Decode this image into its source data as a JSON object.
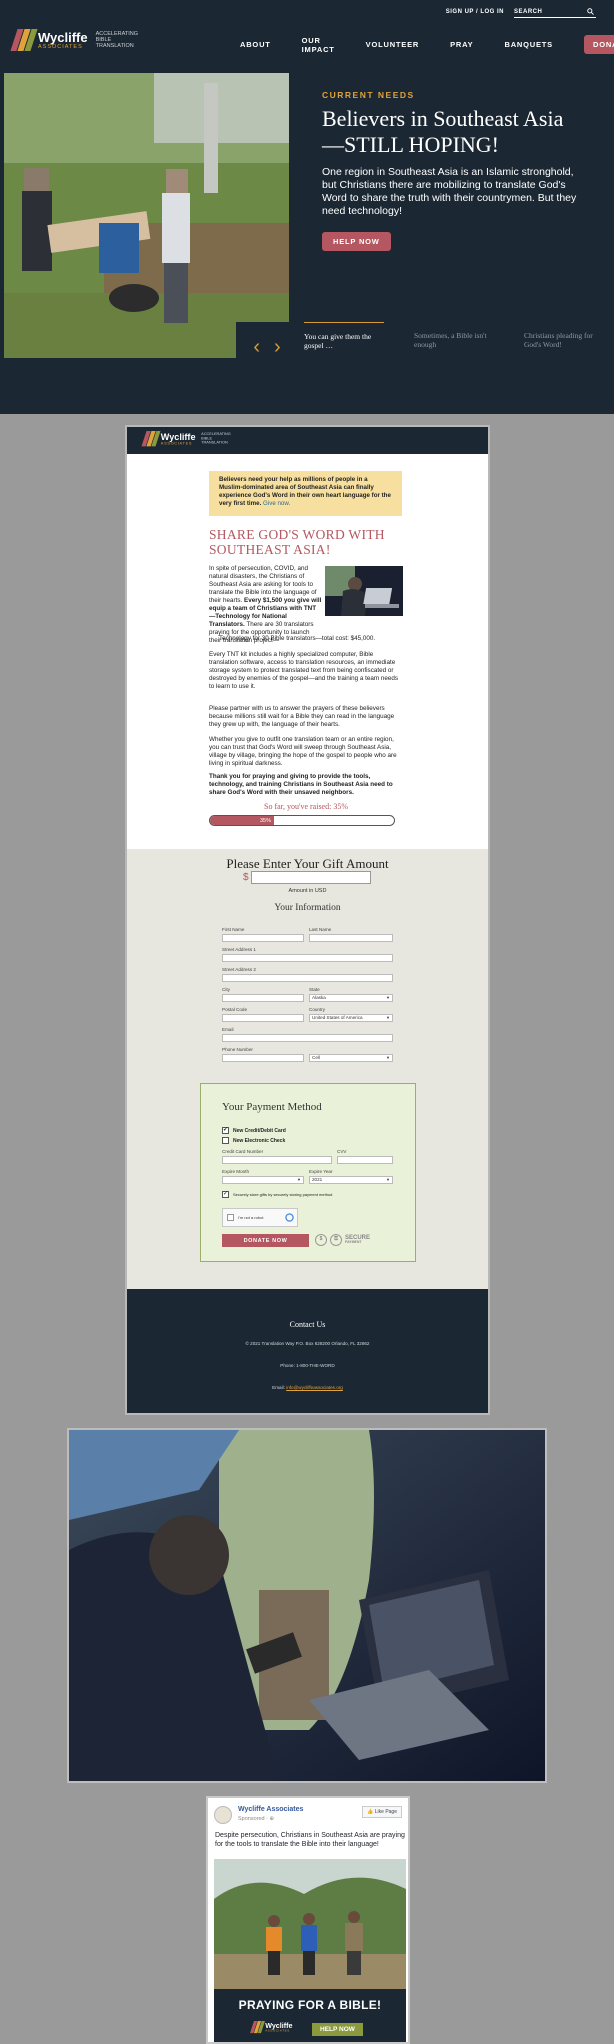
{
  "brand": {
    "name": "Wycliffe",
    "sub": "ASSOCIATES",
    "tagline": [
      "ACCELERATING",
      "BIBLE",
      "TRANSLATION"
    ],
    "colors": {
      "navy": "#1b2833",
      "accent": "#b45760",
      "gold": "#e0a23a"
    }
  },
  "site": {
    "topbar": {
      "signup": "SIGN UP / LOG IN",
      "search_label": "SEARCH",
      "search_icon": "search-icon"
    },
    "nav": [
      "ABOUT",
      "OUR IMPACT",
      "VOLUNTEER",
      "PRAY",
      "BANQUETS"
    ],
    "donate": "DONATE",
    "hero": {
      "eyebrow": "CURRENT NEEDS",
      "title": "Believers in Southeast Asia—STILL HOPING!",
      "body": "One region in Southeast Asia is an Islamic stronghold, but Christians there are mobilizing to translate God's Word to share the truth with their countrymen. But they need technology!",
      "cta": "HELP NOW"
    },
    "slides": [
      "You can give them the gospel …",
      "Sometimes, a Bible isn't enough",
      "Christians pleading for God's Word!"
    ]
  },
  "landing": {
    "banner_text": "Believers need your help as millions of people in a Muslim-dominated area of Southeast Asia can finally experience God's Word in their own heart language for the very first time.",
    "banner_link": "Give now.",
    "title": "SHARE GOD'S WORD WITH SOUTHEAST ASIA!",
    "para1_a": "In spite of persecution, COVID, and natural disasters, the Christians of Southeast Asia are asking for tools to translate the Bible into the language of their hearts.",
    "para1_b": "Every $1,500 you give will equip a team of Christians with TNT—Technology for National Translators.",
    "para1_c": "There are 30 translators praying for the opportunity to launch their translation project—",
    "cost_line": "Technology for 30 Bible translators—total cost: $45,000.",
    "para2": "Every TNT kit includes a highly specialized computer, Bible translation software, access to translation resources, an immediate storage system to protect translated text from being confiscated or destroyed by enemies of the gospel—and the training a team needs to learn to use it.",
    "para3": "Please partner with us to answer the prayers of these believers because millions still wait for a Bible they can read in the language they grew up with, the language of their hearts.",
    "para4": "Whether you give to outfit one translation team or an entire region, you can trust that God's Word will sweep through Southeast Asia, village by village, bringing the hope of the gospel to people who are living in spiritual darkness.",
    "para5": "Thank you for praying and giving to provide the tools, technology, and training Christians in Southeast Asia need to share God's Word with their unsaved neighbors.",
    "raised_label": "So far, you've raised:",
    "raised_value": "35%",
    "progress_percent": 35,
    "progress_text": "35%"
  },
  "form": {
    "gift_title": "Please Enter Your Gift Amount",
    "currency": "$",
    "amount_value": "",
    "amount_label": "Amount in USD",
    "info_title": "Your Information",
    "fields": {
      "first_name": "First Name",
      "last_name": "Last Name",
      "street1": "Street Address 1",
      "street2": "Street Address 2",
      "city": "City",
      "state": "State",
      "state_value": "Alaska",
      "postal": "Postal Code",
      "country": "Country",
      "country_value": "United States of America",
      "email": "Email",
      "phone": "Phone Number",
      "phone_type": "Cell"
    },
    "payment": {
      "title": "Your Payment Method",
      "option_card": "New Credit/Debit Card",
      "option_check": "New Electronic Check",
      "card_number": "Credit Card Number",
      "cvv": "CVV",
      "exp_month": "Expire Month",
      "exp_month_value": "",
      "exp_year": "Expire Year",
      "exp_year_value": "2021",
      "save_label": "Securely store gifts by securely storing payment method",
      "captcha": "I'm not a robot",
      "donate": "DONATE NOW",
      "secure": "SECURE",
      "secure_sub": "PAYMENT"
    }
  },
  "contact": {
    "title": "Contact Us",
    "address": "© 2021 Translation Way P.O. Box 628200 Orlando, FL 32862",
    "phone": "Phone: 1-800-THE-WORD",
    "email_label": "Email:",
    "email": "info@wycliffeassociates.org"
  },
  "fb": {
    "page_name": "Wycliffe Associates",
    "sponsored": "Sponsored · ⊕",
    "like": "👍 Like Page",
    "text": "Despite persecution, Christians in Southeast Asia are praying for the tools to translate the Bible into their language!",
    "banner_title": "PRAYING FOR A BIBLE!",
    "cta": "HELP NOW"
  }
}
